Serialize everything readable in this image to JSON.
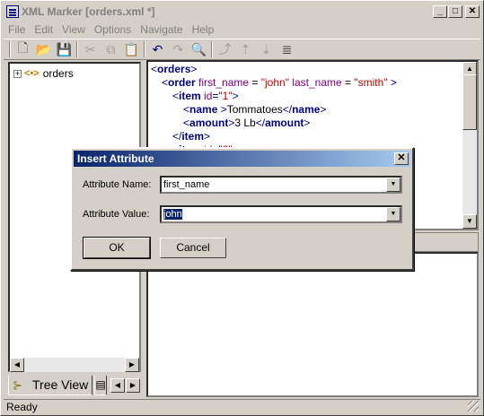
{
  "window": {
    "title": "XML Marker  [orders.xml *]",
    "minimize_glyph": "_",
    "maximize_glyph": "□",
    "close_glyph": "✕"
  },
  "menu": [
    "File",
    "Edit",
    "View",
    "Options",
    "Navigate",
    "Help"
  ],
  "toolbar": [
    {
      "icon": "new-file-icon",
      "glyph": "🗋"
    },
    {
      "icon": "open-folder-icon",
      "glyph": "📂"
    },
    {
      "icon": "save-icon",
      "glyph": "💾"
    },
    {
      "icon": "cut-icon",
      "glyph": "✂"
    },
    {
      "icon": "copy-icon",
      "glyph": "⧉"
    },
    {
      "icon": "paste-icon",
      "glyph": "📋"
    },
    {
      "icon": "undo-icon",
      "glyph": "↶"
    },
    {
      "icon": "redo-icon",
      "glyph": "↷"
    },
    {
      "icon": "find-icon",
      "glyph": "🔍"
    },
    {
      "icon": "add-child-icon",
      "glyph": "⤴"
    },
    {
      "icon": "move-up-icon",
      "glyph": "⇡"
    },
    {
      "icon": "move-down-icon",
      "glyph": "⇣"
    },
    {
      "icon": "indent-icon",
      "glyph": "≣"
    }
  ],
  "tree": {
    "root_label": "orders",
    "expander": "+",
    "tag_glyph": "<•>"
  },
  "tabs": {
    "tree_view": "Tree View",
    "second_tab_glyph": "▤"
  },
  "editor_lines": [
    {
      "indent": 0,
      "parts": [
        {
          "t": "<",
          "c": "#000080"
        },
        {
          "t": "orders",
          "c": "#000080",
          "b": true
        },
        {
          "t": ">",
          "c": "#000080"
        }
      ]
    },
    {
      "indent": 1,
      "parts": [
        {
          "t": "<",
          "c": "#000080"
        },
        {
          "t": "order ",
          "c": "#000080",
          "b": true
        },
        {
          "t": "first_name",
          "c": "#800080"
        },
        {
          "t": " = ",
          "c": "#000"
        },
        {
          "t": "\"john\"",
          "c": "#c00000"
        },
        {
          "t": " last_name",
          "c": "#800080"
        },
        {
          "t": " = ",
          "c": "#000"
        },
        {
          "t": "\"smith\"",
          "c": "#c00000"
        },
        {
          "t": " >",
          "c": "#000080"
        }
      ]
    },
    {
      "indent": 2,
      "parts": [
        {
          "t": "<",
          "c": "#000080"
        },
        {
          "t": "item ",
          "c": "#000080",
          "b": true
        },
        {
          "t": "id",
          "c": "#800080"
        },
        {
          "t": "=",
          "c": "#000"
        },
        {
          "t": "\"1\"",
          "c": "#c00000"
        },
        {
          "t": ">",
          "c": "#000080"
        }
      ]
    },
    {
      "indent": 3,
      "parts": [
        {
          "t": "<",
          "c": "#000080"
        },
        {
          "t": "name",
          "c": "#000080",
          "b": true
        },
        {
          "t": " >",
          "c": "#000080"
        },
        {
          "t": "Tommatoes",
          "c": "#000"
        },
        {
          "t": "</",
          "c": "#000080"
        },
        {
          "t": "name",
          "c": "#000080",
          "b": true
        },
        {
          "t": ">",
          "c": "#000080"
        }
      ]
    },
    {
      "indent": 3,
      "parts": [
        {
          "t": "<",
          "c": "#000080"
        },
        {
          "t": "amount",
          "c": "#000080",
          "b": true
        },
        {
          "t": ">",
          "c": "#000080"
        },
        {
          "t": "3 Lb",
          "c": "#000"
        },
        {
          "t": "</",
          "c": "#000080"
        },
        {
          "t": "amount",
          "c": "#000080",
          "b": true
        },
        {
          "t": ">",
          "c": "#000080"
        }
      ]
    },
    {
      "indent": 2,
      "parts": [
        {
          "t": "</",
          "c": "#000080"
        },
        {
          "t": "item",
          "c": "#000080",
          "b": true
        },
        {
          "t": ">",
          "c": "#000080"
        }
      ]
    },
    {
      "indent": 2,
      "parts": [
        {
          "t": "<",
          "c": "#000080"
        },
        {
          "t": "item ",
          "c": "#000080",
          "b": true
        },
        {
          "t": "id",
          "c": "#800080"
        },
        {
          "t": "=",
          "c": "#000"
        },
        {
          "t": "\"2\"",
          "c": "#c00000"
        }
      ]
    }
  ],
  "status": {
    "text": "Ready"
  },
  "dialog": {
    "title": "Insert Attribute",
    "close_glyph": "✕",
    "name_label": "Attribute Name:",
    "name_value": "first_name",
    "value_label": "Attribute Value:",
    "value_value": "john",
    "ok_label": "OK",
    "cancel_label": "Cancel",
    "dropdown_glyph": "▼"
  },
  "scroll_glyphs": {
    "up": "▲",
    "down": "▼",
    "left": "◀",
    "right": "▶"
  }
}
